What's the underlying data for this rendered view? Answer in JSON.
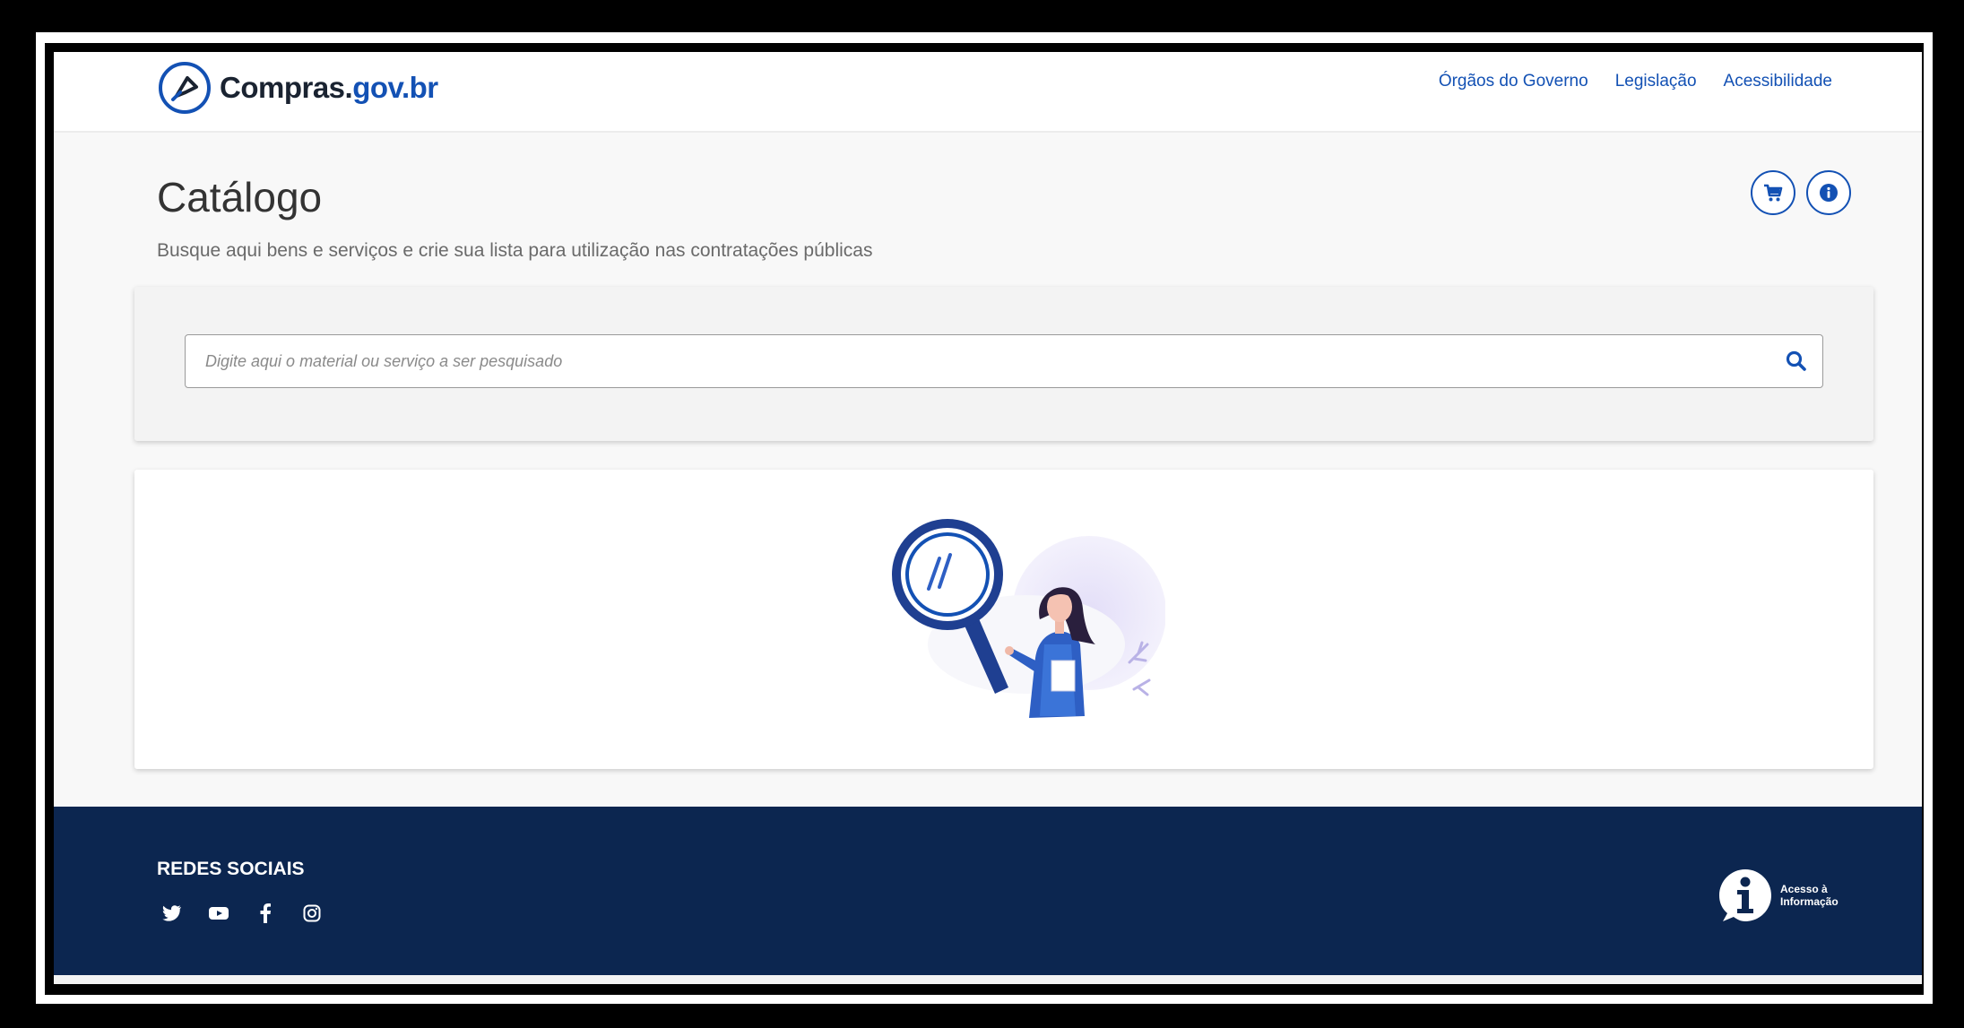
{
  "header": {
    "logo_main": "Compras.",
    "logo_accent": "gov.br",
    "nav": [
      "Órgãos do Governo",
      "Legislação",
      "Acessibilidade"
    ]
  },
  "main": {
    "title": "Catálogo",
    "subtitle": "Busque aqui bens e serviços e crie sua lista para utilização nas contratações públicas",
    "search_placeholder": "Digite aqui o material ou serviço a ser pesquisado"
  },
  "footer": {
    "social_title": "REDES SOCIAIS",
    "social_icons": [
      "twitter-icon",
      "youtube-icon",
      "facebook-icon",
      "instagram-icon"
    ],
    "acesso_line1": "Acesso à",
    "acesso_line2": "Informação"
  },
  "colors": {
    "brand_blue": "#1351b4",
    "footer_bg": "#0c2650"
  }
}
